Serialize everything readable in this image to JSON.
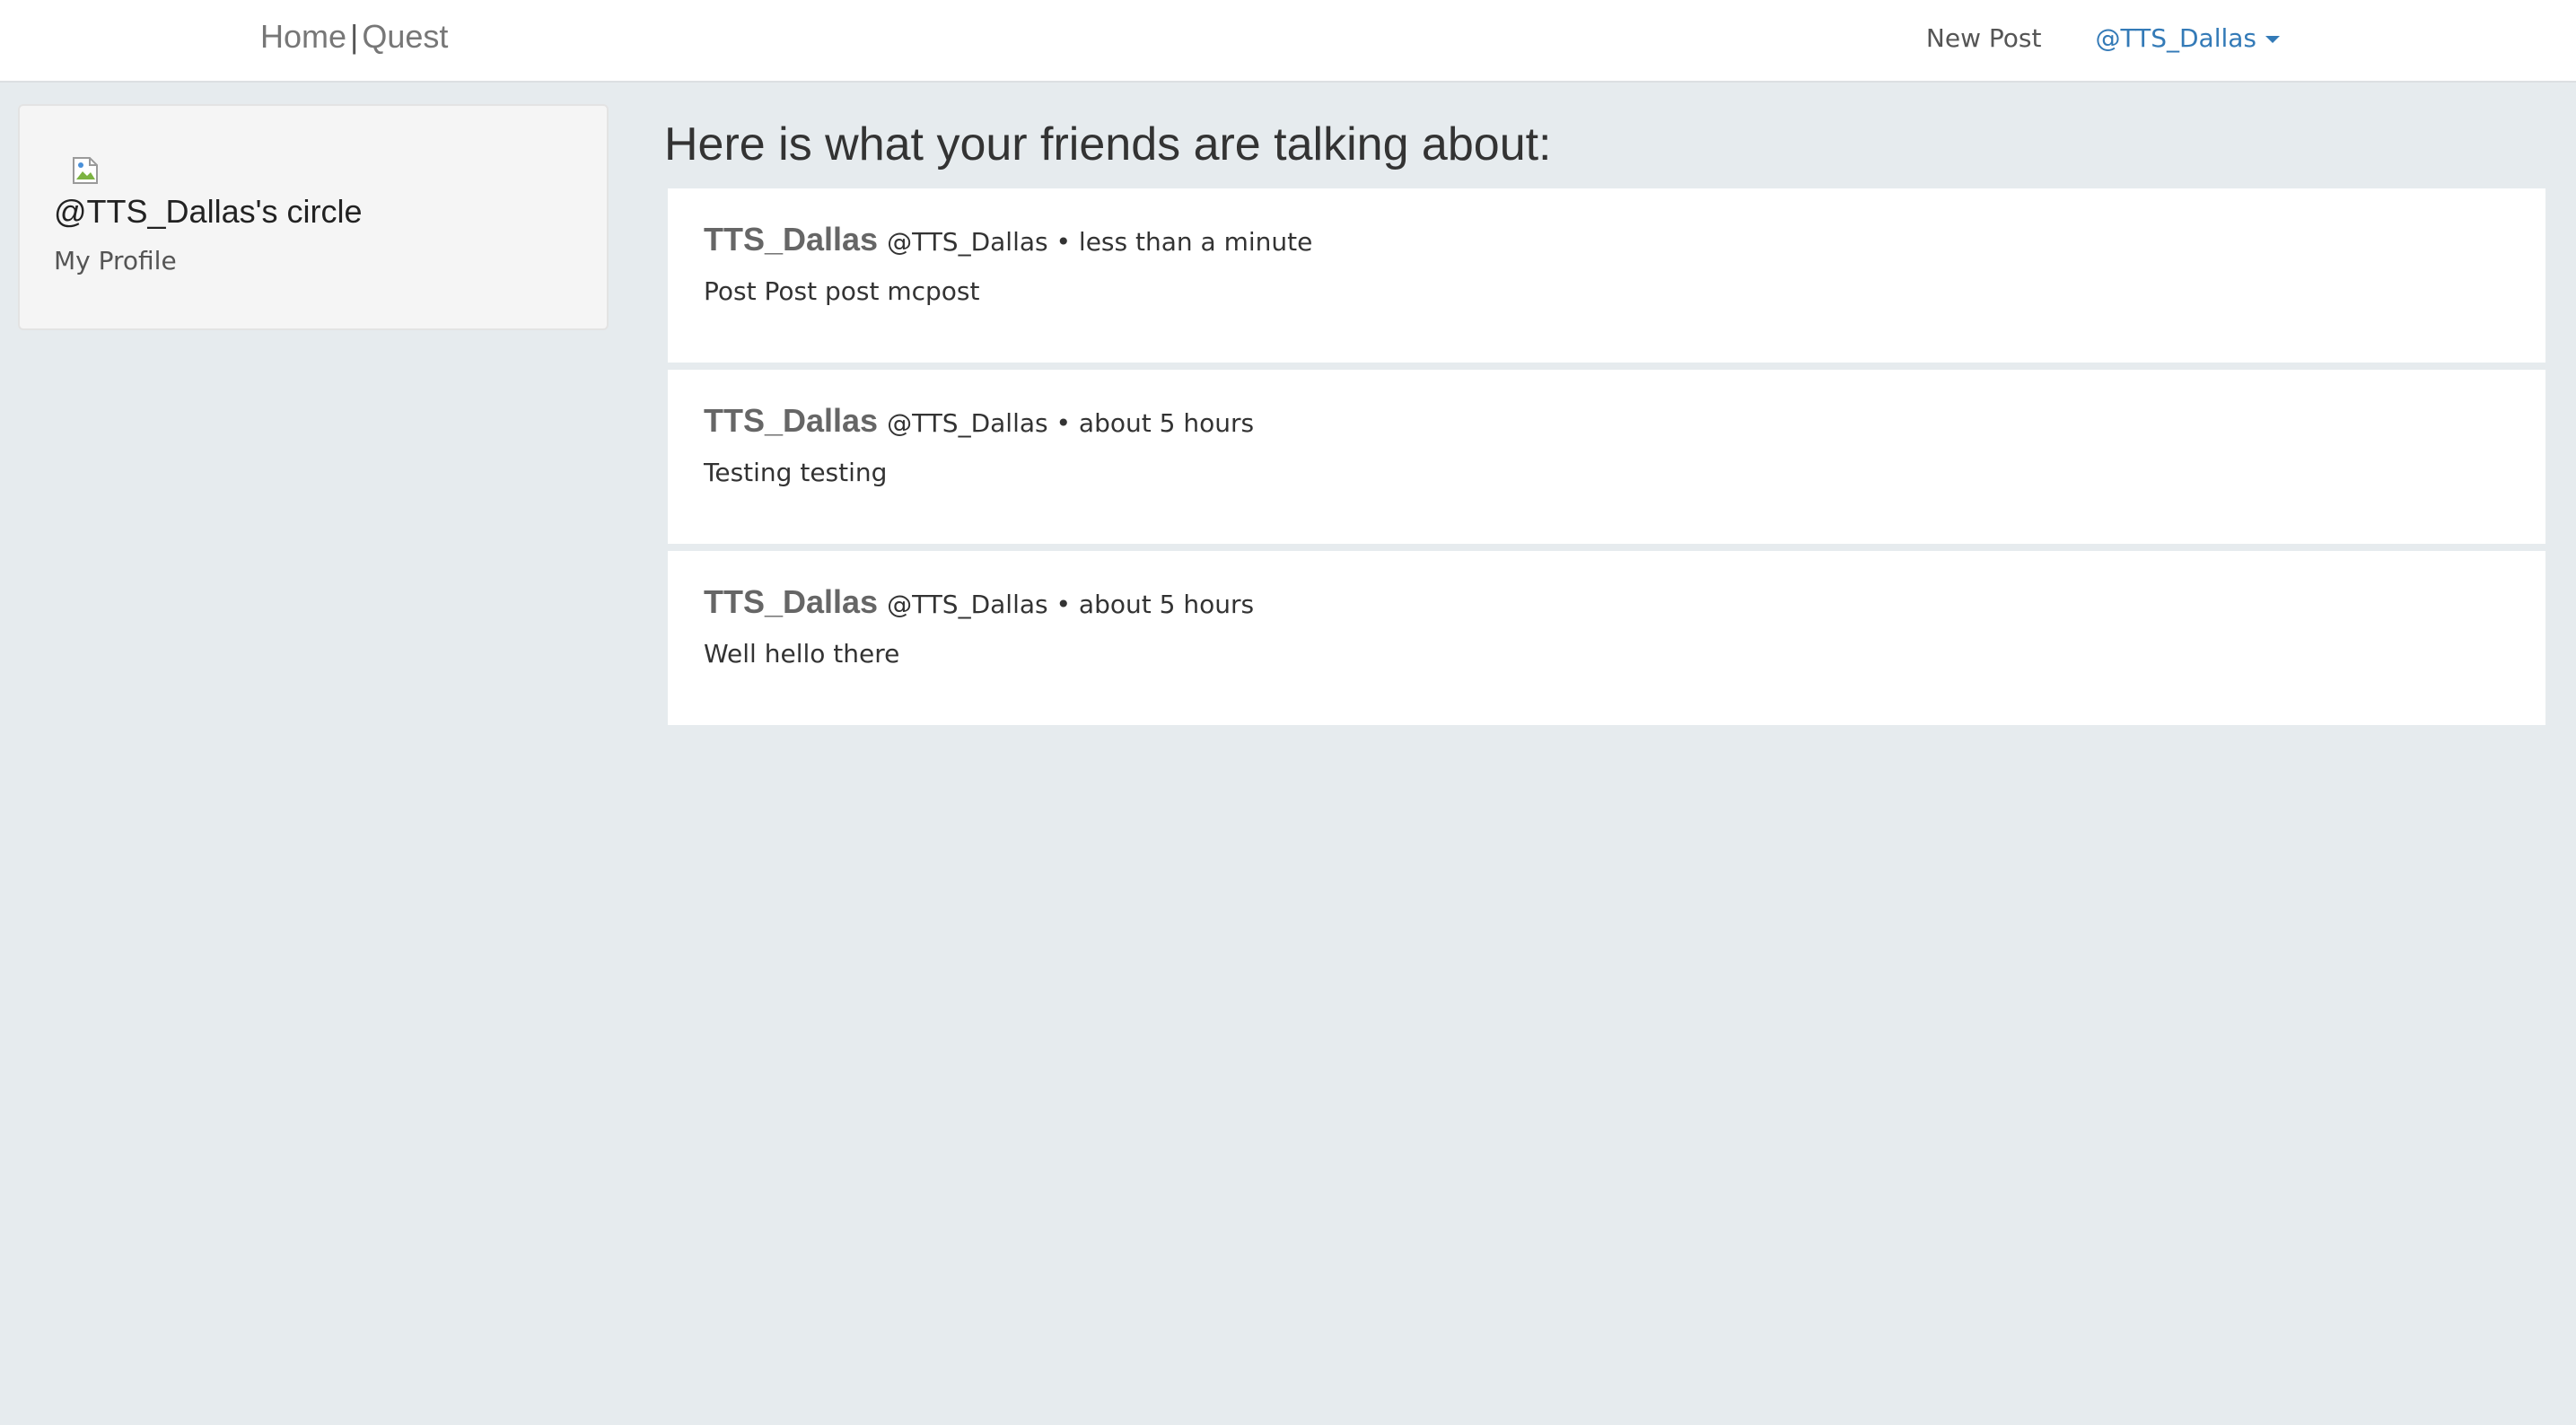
{
  "nav": {
    "brand_home": "Home",
    "brand_separator": "|",
    "brand_quest": "Quest",
    "new_post": "New Post",
    "user_handle": "@TTS_Dallas"
  },
  "sidebar": {
    "circle_title": "@TTS_Dallas's circle",
    "profile_link": "My Profile"
  },
  "feed": {
    "heading": "Here is what your friends are talking about:",
    "posts": [
      {
        "name": "TTS_Dallas",
        "meta": "@TTS_Dallas • less than a minute",
        "body": "Post Post post mcpost"
      },
      {
        "name": "TTS_Dallas",
        "meta": "@TTS_Dallas • about 5 hours",
        "body": "Testing testing"
      },
      {
        "name": "TTS_Dallas",
        "meta": "@TTS_Dallas • about 5 hours",
        "body": "Well hello there"
      }
    ]
  },
  "colors": {
    "page_background": "#e6ebee",
    "link_accent": "#337ab7"
  },
  "icons": {
    "avatar": "broken-image-icon",
    "dropdown": "caret-down-icon"
  }
}
